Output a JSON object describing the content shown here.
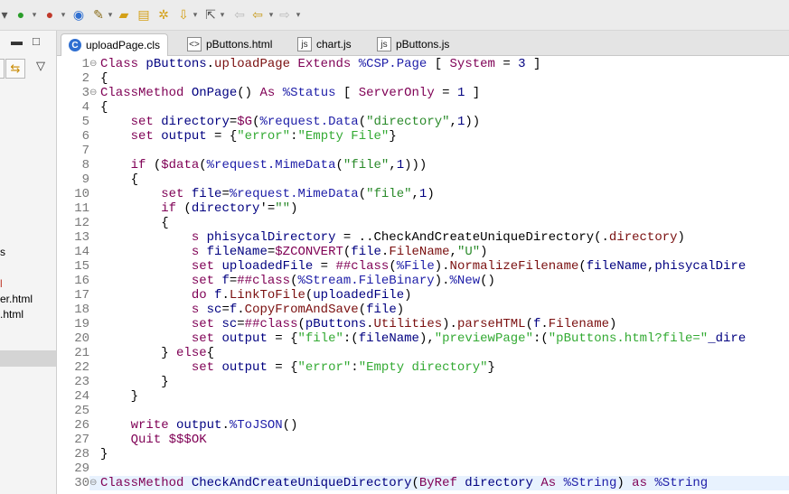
{
  "tabs": [
    {
      "label": "uploadPage.cls",
      "icon": "cls-file-icon",
      "active": true
    },
    {
      "label": "pButtons.html",
      "icon": "html-file-icon",
      "active": false
    },
    {
      "label": "chart.js",
      "icon": "js-file-icon",
      "active": false
    },
    {
      "label": "pButtons.js",
      "icon": "js-file-icon",
      "active": false
    }
  ],
  "left_panel": {
    "items": [
      {
        "text": "s"
      },
      {
        "text": "l"
      },
      {
        "text": "er.html"
      },
      {
        "text": ".html"
      }
    ]
  },
  "code": {
    "line_numbers": [
      "1",
      "2",
      "3",
      "4",
      "5",
      "6",
      "7",
      "8",
      "9",
      "10",
      "11",
      "12",
      "13",
      "14",
      "15",
      "16",
      "17",
      "18",
      "19",
      "20",
      "21",
      "22",
      "23",
      "24",
      "25",
      "26",
      "27",
      "28",
      "29",
      "30"
    ],
    "lines": [
      "Class pButtons.uploadPage Extends %CSP.Page [ System = 3 ]",
      "{",
      "ClassMethod OnPage() As %Status [ ServerOnly = 1 ]",
      "{",
      "    set directory=$G(%request.Data(\"directory\",1))",
      "    set output = {\"error\":\"Empty File\"}",
      "",
      "    if ($data(%request.MimeData(\"file\",1)))",
      "    {",
      "        set file=%request.MimeData(\"file\",1)",
      "        if (directory'=\"\")",
      "        {",
      "            s phisycalDirectory = ..CheckAndCreateUniqueDirectory(.directory)",
      "            s fileName=$ZCONVERT(file.FileName,\"U\")",
      "            set uploadedFile = ##class(%File).NormalizeFilename(fileName,phisycalDire",
      "            set f=##class(%Stream.FileBinary).%New()",
      "            do f.LinkToFile(uploadedFile)",
      "            s sc=f.CopyFromAndSave(file)",
      "            set sc=##class(pButtons.Utilities).parseHTML(f.Filename)",
      "            set output = {\"file\":(fileName),\"previewPage\":(\"pButtons.html?file=\"_dire",
      "        } else{",
      "            set output = {\"error\":\"Empty directory\"}",
      "        }",
      "    }",
      "",
      "    write output.%ToJSON()",
      "    Quit $$$OK",
      "}",
      "",
      "ClassMethod CheckAndCreateUniqueDirectory(ByRef directory As %String) as %String"
    ]
  },
  "colors": {
    "keyword": "#7f0055",
    "string": "#2a8a2a",
    "linenumber": "#787878"
  }
}
